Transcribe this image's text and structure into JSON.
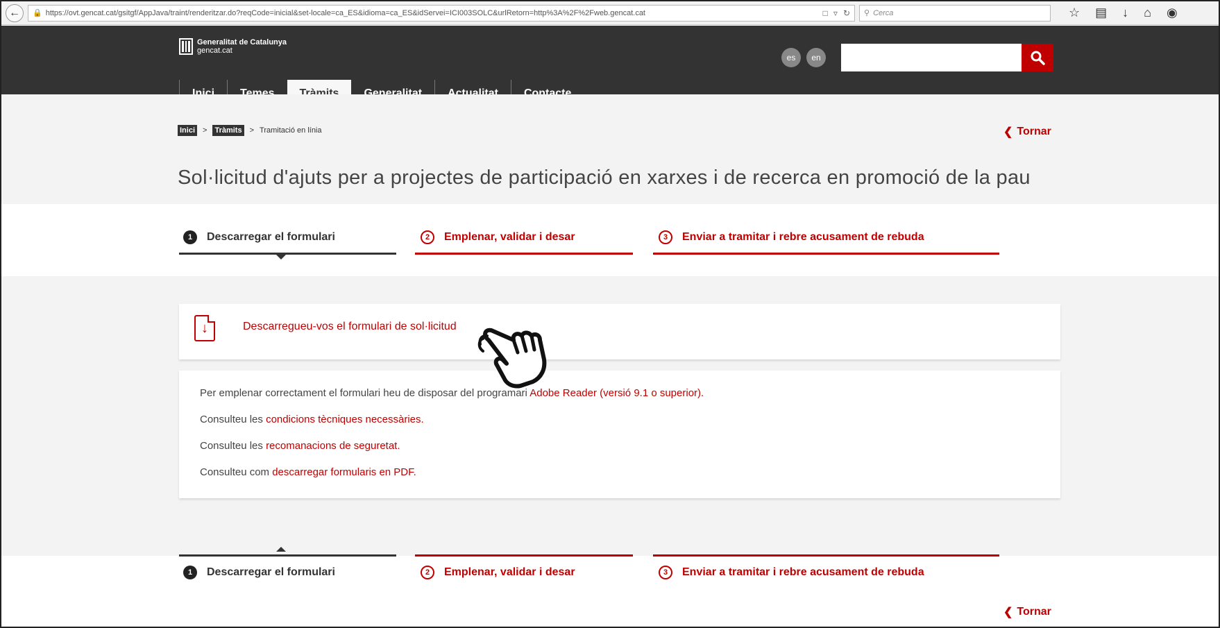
{
  "browser": {
    "url": "https://ovt.gencat.cat/gsitgf/AppJava/traint/renderitzar.do?reqCode=inicial&set-locale=ca_ES&idioma=ca_ES&idServei=ICI003SOLC&urlRetorn=http%3A%2F%2Fweb.gencat.cat",
    "search_placeholder": "Cerca"
  },
  "header": {
    "logo_line1": "Generalitat de Catalunya",
    "logo_line2": "gencat.cat",
    "lang_es": "es",
    "lang_en": "en",
    "nav": [
      {
        "label": "Inici"
      },
      {
        "label": "Temes"
      },
      {
        "label": "Tràmits"
      },
      {
        "label": "Generalitat"
      },
      {
        "label": "Actualitat"
      },
      {
        "label": "Contacte"
      }
    ]
  },
  "breadcrumb": {
    "items": [
      "Inici",
      "Tràmits",
      "Tramitació en línia"
    ],
    "separator": ">"
  },
  "back_label": "Tornar",
  "page_title": "Sol·licitud d'ajuts per a projectes de participació en xarxes i de recerca en promoció de la pau",
  "steps": [
    {
      "num": "1",
      "label": "Descarregar el formulari"
    },
    {
      "num": "2",
      "label": "Emplenar, validar i desar"
    },
    {
      "num": "3",
      "label": "Enviar a tramitar i rebre acusament de rebuda"
    }
  ],
  "download": {
    "link": "Descarregueu-vos el formulari de sol·licitud"
  },
  "info": {
    "line1_text": "Per emplenar correctament el formulari heu de disposar del programari ",
    "line1_link": "Adobe Reader (versió 9.1 o superior).",
    "line2_text": "Consulteu les ",
    "line2_link": "condicions tècniques necessàries.",
    "line3_text": "Consulteu les ",
    "line3_link": "recomanacions de seguretat.",
    "line4_text": "Consulteu com ",
    "line4_link": "descarregar formularis en PDF."
  },
  "colors": {
    "accent": "#c00000",
    "header_bg": "#333333",
    "page_grey": "#f3f3f3"
  }
}
